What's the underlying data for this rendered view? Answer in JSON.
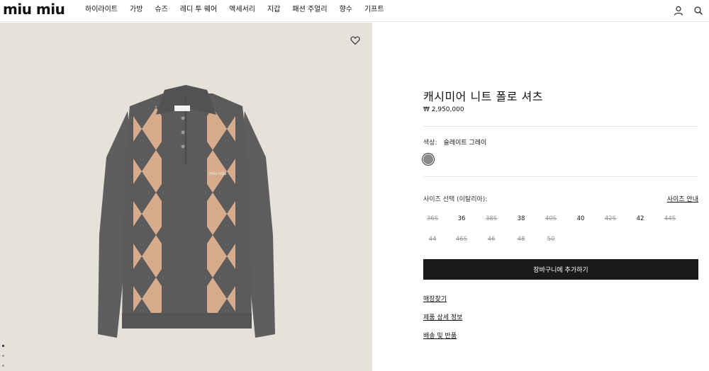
{
  "header": {
    "logo": "miu miu",
    "nav": [
      "하이라이트",
      "가방",
      "슈즈",
      "레디 투 웨어",
      "액세서리",
      "지갑",
      "패션 주얼리",
      "향수",
      "기프트"
    ]
  },
  "product": {
    "title": "캐시미어 니트 폴로 셔츠",
    "price": "₩ 2,950,000",
    "color_label": "색상:",
    "color_value": "슬레이트 그레이",
    "swatch_color": "#8a8a8a",
    "size_label": "사이즈 선택 (이탈리아):",
    "size_guide": "사이즈 안내",
    "sizes": [
      {
        "label": "36S",
        "available": false
      },
      {
        "label": "36",
        "available": true
      },
      {
        "label": "38S",
        "available": false
      },
      {
        "label": "38",
        "available": true
      },
      {
        "label": "40S",
        "available": false
      },
      {
        "label": "40",
        "available": true
      },
      {
        "label": "42S",
        "available": false
      },
      {
        "label": "42",
        "available": true
      },
      {
        "label": "44S",
        "available": false
      },
      {
        "label": "44",
        "available": false
      },
      {
        "label": "46S",
        "available": false
      },
      {
        "label": "46",
        "available": false
      },
      {
        "label": "48",
        "available": false
      },
      {
        "label": "50",
        "available": false
      }
    ],
    "cart_button": "장바구니에 추가하기",
    "links": [
      "매장찾기",
      "제품 상세 정보",
      "배송 및 반품"
    ]
  },
  "colors": {
    "sweater_gray": "#5b5b5b",
    "argyle_peach": "#dcb08f",
    "pane_bg": "#e6e1da"
  }
}
